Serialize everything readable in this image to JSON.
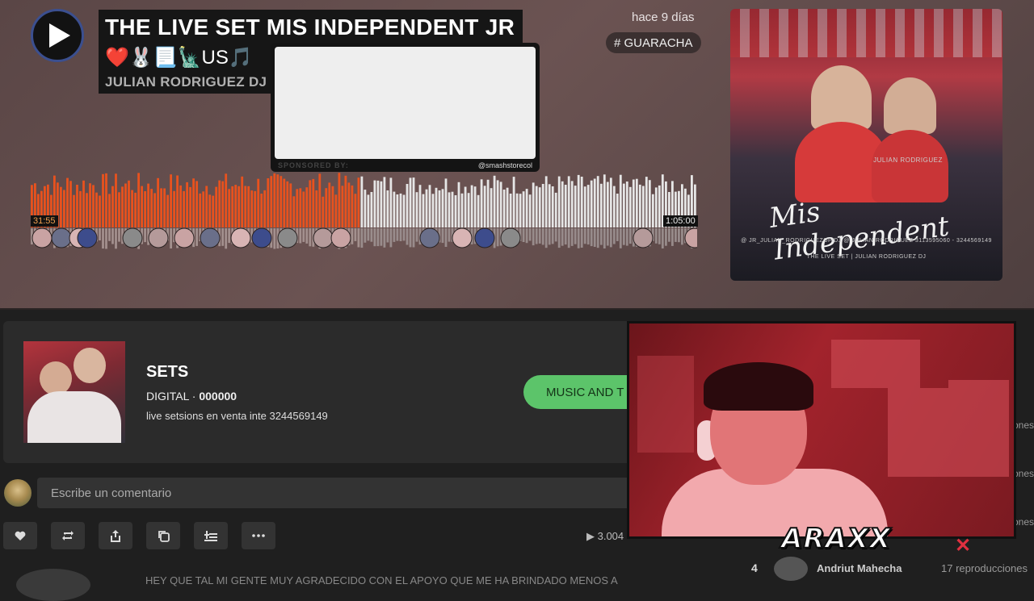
{
  "track": {
    "title": "THE LIVE SET MIS INDEPENDENT JR",
    "title_emojis": "❤️🐰📃🗽US🎵",
    "artist": "JULIAN RODRIGUEZ DJ",
    "posted": "hace 9 días",
    "tag": "# GUARACHA",
    "current_time": "31:55",
    "total_time": "1:05:00",
    "progress": 0.491
  },
  "sponsor": {
    "label": "SPONSORED BY:",
    "handle": "@smashstorecol"
  },
  "artwork": {
    "title": "Mis Independent",
    "name": "JULIAN RODRIGUEZ",
    "credits": "@ JR_JULIAN_RODRIGUEZOFIDJ    @ JULIAN RODRIGUEZ 3113595060 - 3244569149",
    "footer": "THE LIVE SET | JULIAN RODRIGUEZ DJ"
  },
  "info": {
    "title": "SETS",
    "type": "DIGITAL",
    "price": "000000",
    "description": "live setsions en venta inte 3244569149",
    "button": "MUSIC AND T"
  },
  "comment": {
    "placeholder": "Escribe un comentario"
  },
  "actions": [
    {
      "name": "like-button",
      "icon": "heart-icon"
    },
    {
      "name": "repost-button",
      "icon": "repost-icon"
    },
    {
      "name": "share-button",
      "icon": "share-icon"
    },
    {
      "name": "copy-link-button",
      "icon": "copy-icon"
    },
    {
      "name": "add-to-playlist-button",
      "icon": "playlist-add-icon"
    },
    {
      "name": "more-button",
      "icon": "ellipsis-icon"
    }
  ],
  "plays": "▶ 3.004",
  "side_stats": [
    "ones",
    "ones",
    "reproducciones"
  ],
  "comment_peek": "HEY QUE TAL MI GENTE MUY AGRADECIDO CON EL APOYO QUE ME HA BRINDADO MENOS A",
  "listener": {
    "count": "4",
    "name": "Andriut Mahecha",
    "plays": "17 reproducciones"
  },
  "overlay": {
    "brand": "ARAXX"
  },
  "colors": {
    "played": "#e8521e",
    "unplayed": "#e6e6e6",
    "accent_green": "#5cc46a"
  }
}
